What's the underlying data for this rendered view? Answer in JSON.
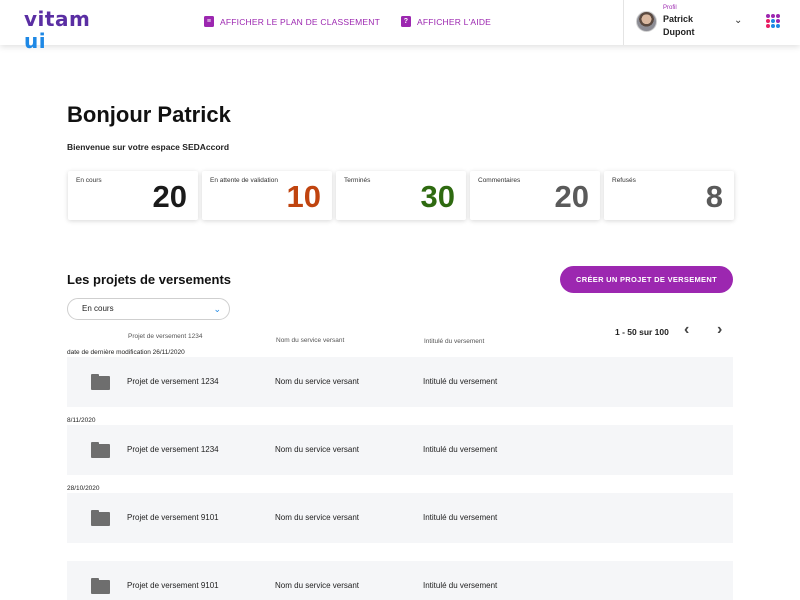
{
  "header": {
    "logo_main": "vitam",
    "logo_accent": "ui",
    "nav": [
      {
        "label": "Afficher le plan de classement",
        "icon": "clipboard-icon"
      },
      {
        "label": "Afficher l'aide",
        "icon": "help-icon"
      }
    ],
    "profile": {
      "label": "Profil",
      "first_name": "Patrick",
      "last_name": "Dupont"
    },
    "app_dots": [
      "#9c27b0",
      "#9c27b0",
      "#9c27b0",
      "#e91e63",
      "#1e88e5",
      "#9c27b0",
      "#e91e63",
      "#1e88e5",
      "#1e88e5"
    ]
  },
  "greeting": {
    "title": "Bonjour Patrick",
    "subtitle": "Bienvenue sur votre espace SEDAccord"
  },
  "stats": [
    {
      "label": "En cours",
      "value": "20",
      "color": "#1a1a1a"
    },
    {
      "label": "En attente de validation",
      "value": "10",
      "color": "#c0440f"
    },
    {
      "label": "Terminés",
      "value": "30",
      "color": "#2e6a10"
    },
    {
      "label": "Commentaires",
      "value": "20",
      "color": "#5a5a5a"
    },
    {
      "label": "Refusés",
      "value": "8",
      "color": "#5a5a5a"
    }
  ],
  "section": {
    "title": "Les projets de versements",
    "create_button": "Créer un projet de versement",
    "filter_value": "En cours"
  },
  "table": {
    "headers": [
      "Projet de versement 1234",
      "Nom du service versant",
      "Intitulé du versement"
    ],
    "first_date_label": "date de dernière modification 26/11/2020",
    "pager": "1 - 50 sur 100",
    "groups": [
      {
        "date": "",
        "name": "Projet de versement 1234",
        "service": "Nom du service versant",
        "title": "Intitulé du versement"
      },
      {
        "date": "8/11/2020",
        "name": "Projet de versement 1234",
        "service": "Nom du service versant",
        "title": "Intitulé du versement"
      },
      {
        "date": "28/10/2020",
        "name": "Projet de versement 9101",
        "service": "Nom du service versant",
        "title": "Intitulé du versement"
      },
      {
        "date": "",
        "name": "Projet de versement 9101",
        "service": "Nom du service versant",
        "title": "Intitulé du versement"
      }
    ]
  }
}
